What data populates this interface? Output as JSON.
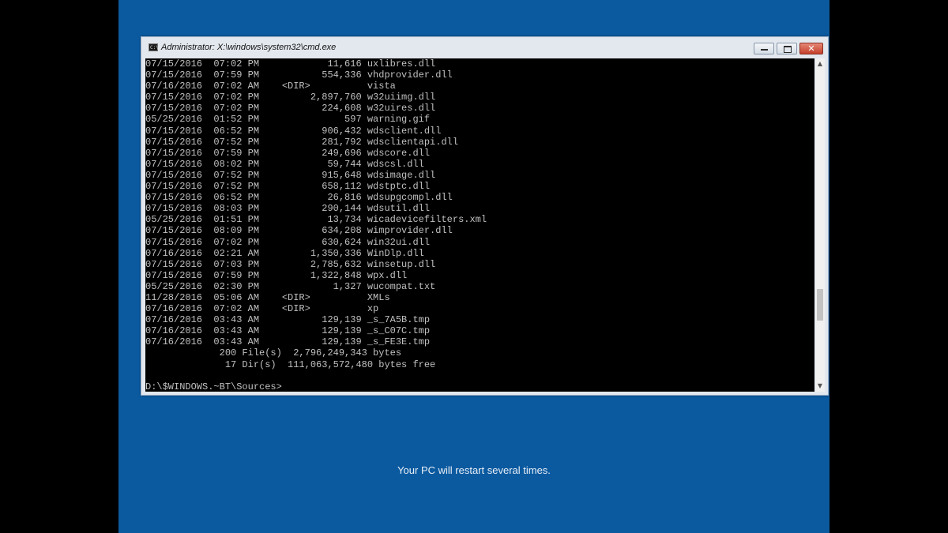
{
  "footer": {
    "message": "Your PC will restart several times."
  },
  "window": {
    "title": "Administrator: X:\\windows\\system32\\cmd.exe",
    "icon": "cmd-icon",
    "icon_text": "C:\\",
    "buttons": {
      "minimize": "minimize-icon",
      "maximize": "maximize-icon",
      "close": "close-icon",
      "close_glyph": "✕"
    },
    "colors": {
      "desktop": "#0B5AA0",
      "console_bg": "#000000",
      "console_text": "#C0C0C0",
      "close": "#C4402B"
    }
  },
  "console": {
    "lines": [
      "07/15/2016  07:02 PM            11,616 uxlibres.dll",
      "07/15/2016  07:59 PM           554,336 vhdprovider.dll",
      "07/16/2016  07:02 AM    <DIR>          vista",
      "07/15/2016  07:02 PM         2,897,760 w32uiimg.dll",
      "07/15/2016  07:02 PM           224,608 w32uires.dll",
      "05/25/2016  01:52 PM               597 warning.gif",
      "07/15/2016  06:52 PM           906,432 wdsclient.dll",
      "07/15/2016  07:52 PM           281,792 wdsclientapi.dll",
      "07/15/2016  07:59 PM           249,696 wdscore.dll",
      "07/15/2016  08:02 PM            59,744 wdscsl.dll",
      "07/15/2016  07:52 PM           915,648 wdsimage.dll",
      "07/15/2016  07:52 PM           658,112 wdstptc.dll",
      "07/15/2016  06:52 PM            26,816 wdsupgcompl.dll",
      "07/15/2016  08:03 PM           290,144 wdsutil.dll",
      "05/25/2016  01:51 PM            13,734 wicadevicefilters.xml",
      "07/15/2016  08:09 PM           634,208 wimprovider.dll",
      "07/15/2016  07:02 PM           630,624 win32ui.dll",
      "07/16/2016  02:21 AM         1,350,336 WinDlp.dll",
      "07/15/2016  07:03 PM         2,785,632 winsetup.dll",
      "07/15/2016  07:59 PM         1,322,848 wpx.dll",
      "05/25/2016  02:30 PM             1,327 wucompat.txt",
      "11/28/2016  05:06 AM    <DIR>          XMLs",
      "07/16/2016  07:02 AM    <DIR>          xp",
      "07/16/2016  03:43 AM           129,139 _s_7A5B.tmp",
      "07/16/2016  03:43 AM           129,139 _s_C07C.tmp",
      "07/16/2016  03:43 AM           129,139 _s_FE3E.tmp",
      "             200 File(s)  2,796,249,343 bytes",
      "              17 Dir(s)  111,063,572,480 bytes free",
      "",
      "D:\\$WINDOWS.~BT\\Sources>"
    ]
  },
  "scrollbar": {
    "up_glyph": "▲",
    "down_glyph": "▼"
  }
}
